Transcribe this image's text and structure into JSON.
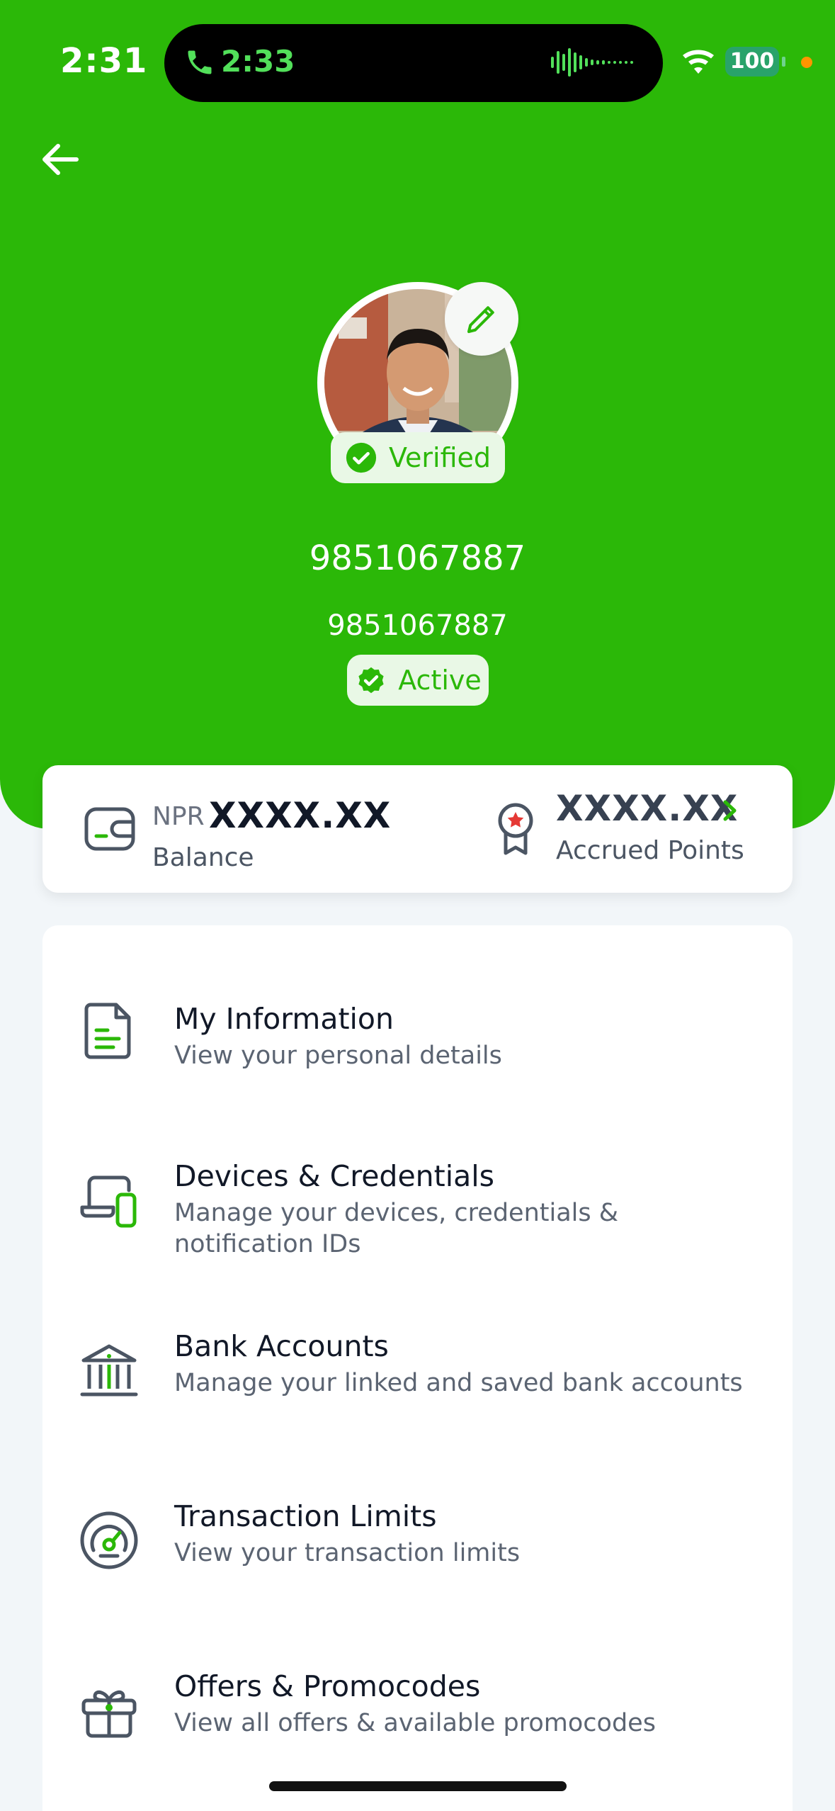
{
  "status_bar": {
    "time": "2:31",
    "call_time": "2:33",
    "battery": "100"
  },
  "profile": {
    "verified_label": "Verified",
    "phone_primary": "9851067887",
    "phone_secondary": "9851067887",
    "status_label": "Active"
  },
  "balance_card": {
    "currency": "NPR",
    "balance_value": "XXXX.XX",
    "balance_label": "Balance",
    "points_value": "XXXX.XX",
    "points_label": "Accrued Points"
  },
  "menu": {
    "items": [
      {
        "title": "My Information",
        "subtitle": "View your personal details",
        "icon": "document-icon"
      },
      {
        "title": "Devices & Credentials",
        "subtitle": "Manage your devices, credentials & notification IDs",
        "icon": "devices-icon"
      },
      {
        "title": "Bank Accounts",
        "subtitle": "Manage your linked and saved bank accounts",
        "icon": "bank-icon"
      },
      {
        "title": "Transaction Limits",
        "subtitle": "View your transaction limits",
        "icon": "gauge-icon"
      },
      {
        "title": "Offers & Promocodes",
        "subtitle": "View all offers & available promocodes",
        "icon": "gift-icon"
      }
    ]
  },
  "colors": {
    "brand_green": "#2bb808",
    "badge_bg": "#e9f8e6",
    "page_bg": "#f2f6f9"
  }
}
